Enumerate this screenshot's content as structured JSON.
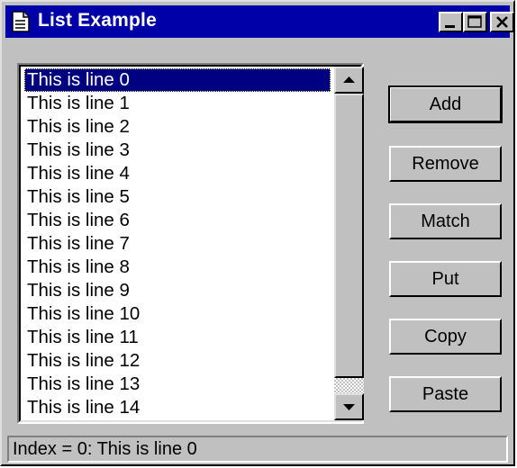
{
  "window": {
    "title": "List Example"
  },
  "listbox": {
    "selected_index": 0,
    "items": [
      "This is line 0",
      "This is line 1",
      "This is line 2",
      "This is line 3",
      "This is line 4",
      "This is line 5",
      "This is line 6",
      "This is line 7",
      "This is line 8",
      "This is line 9",
      "This is line 10",
      "This is line 11",
      "This is line 12",
      "This is line 13",
      "This is line 14"
    ]
  },
  "buttons": {
    "add": "Add",
    "remove": "Remove",
    "match": "Match",
    "put": "Put",
    "copy": "Copy",
    "paste": "Paste"
  },
  "status": {
    "text": "Index = 0: This is line 0"
  },
  "colors": {
    "titlebar": "#0000a8",
    "selection": "#000080",
    "face": "#c0c0c0"
  }
}
